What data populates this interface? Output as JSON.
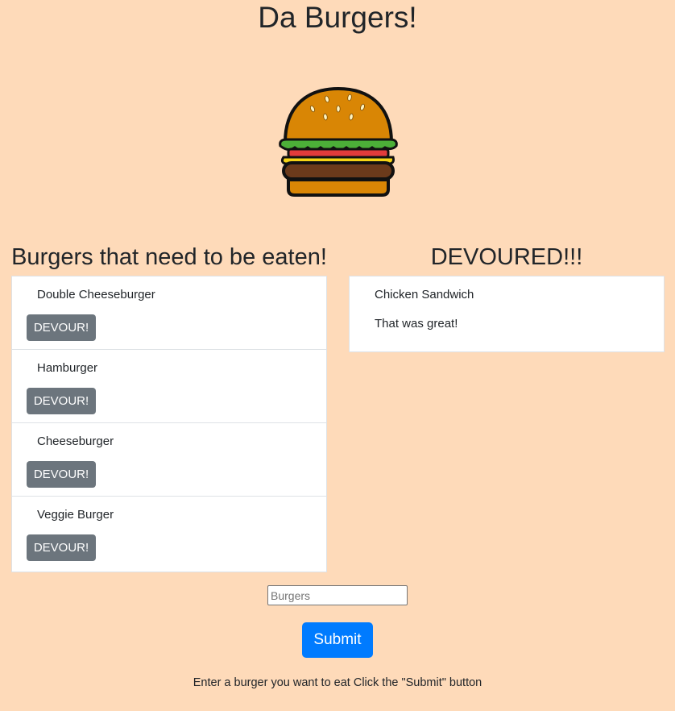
{
  "page": {
    "title": "Da Burgers!"
  },
  "logo": {
    "icon": "burger-icon",
    "colors": {
      "bun": "#d98605",
      "lettuce": "#4caf38",
      "tomato": "#e23b3b",
      "cheese": "#f4d316",
      "patty": "#6b3a1b",
      "outline": "#111111"
    }
  },
  "to_eat": {
    "heading": "Burgers that need to be eaten!",
    "items": [
      {
        "name": "Double Cheeseburger",
        "button": "DEVOUR!"
      },
      {
        "name": "Hamburger",
        "button": "DEVOUR!"
      },
      {
        "name": "Cheeseburger",
        "button": "DEVOUR!"
      },
      {
        "name": "Veggie Burger",
        "button": "DEVOUR!"
      }
    ]
  },
  "devoured": {
    "heading": "DEVOURED!!!",
    "items": [
      {
        "name": "Chicken Sandwich",
        "note": "That was great!"
      }
    ]
  },
  "form": {
    "placeholder": "Burgers",
    "value": "",
    "submit_label": "Submit",
    "instructions": "Enter a burger you want to eat Click the \"Submit\" button"
  },
  "colors": {
    "background": "#fedab9",
    "devour_button": "#6c757d",
    "submit_button": "#007bff"
  }
}
